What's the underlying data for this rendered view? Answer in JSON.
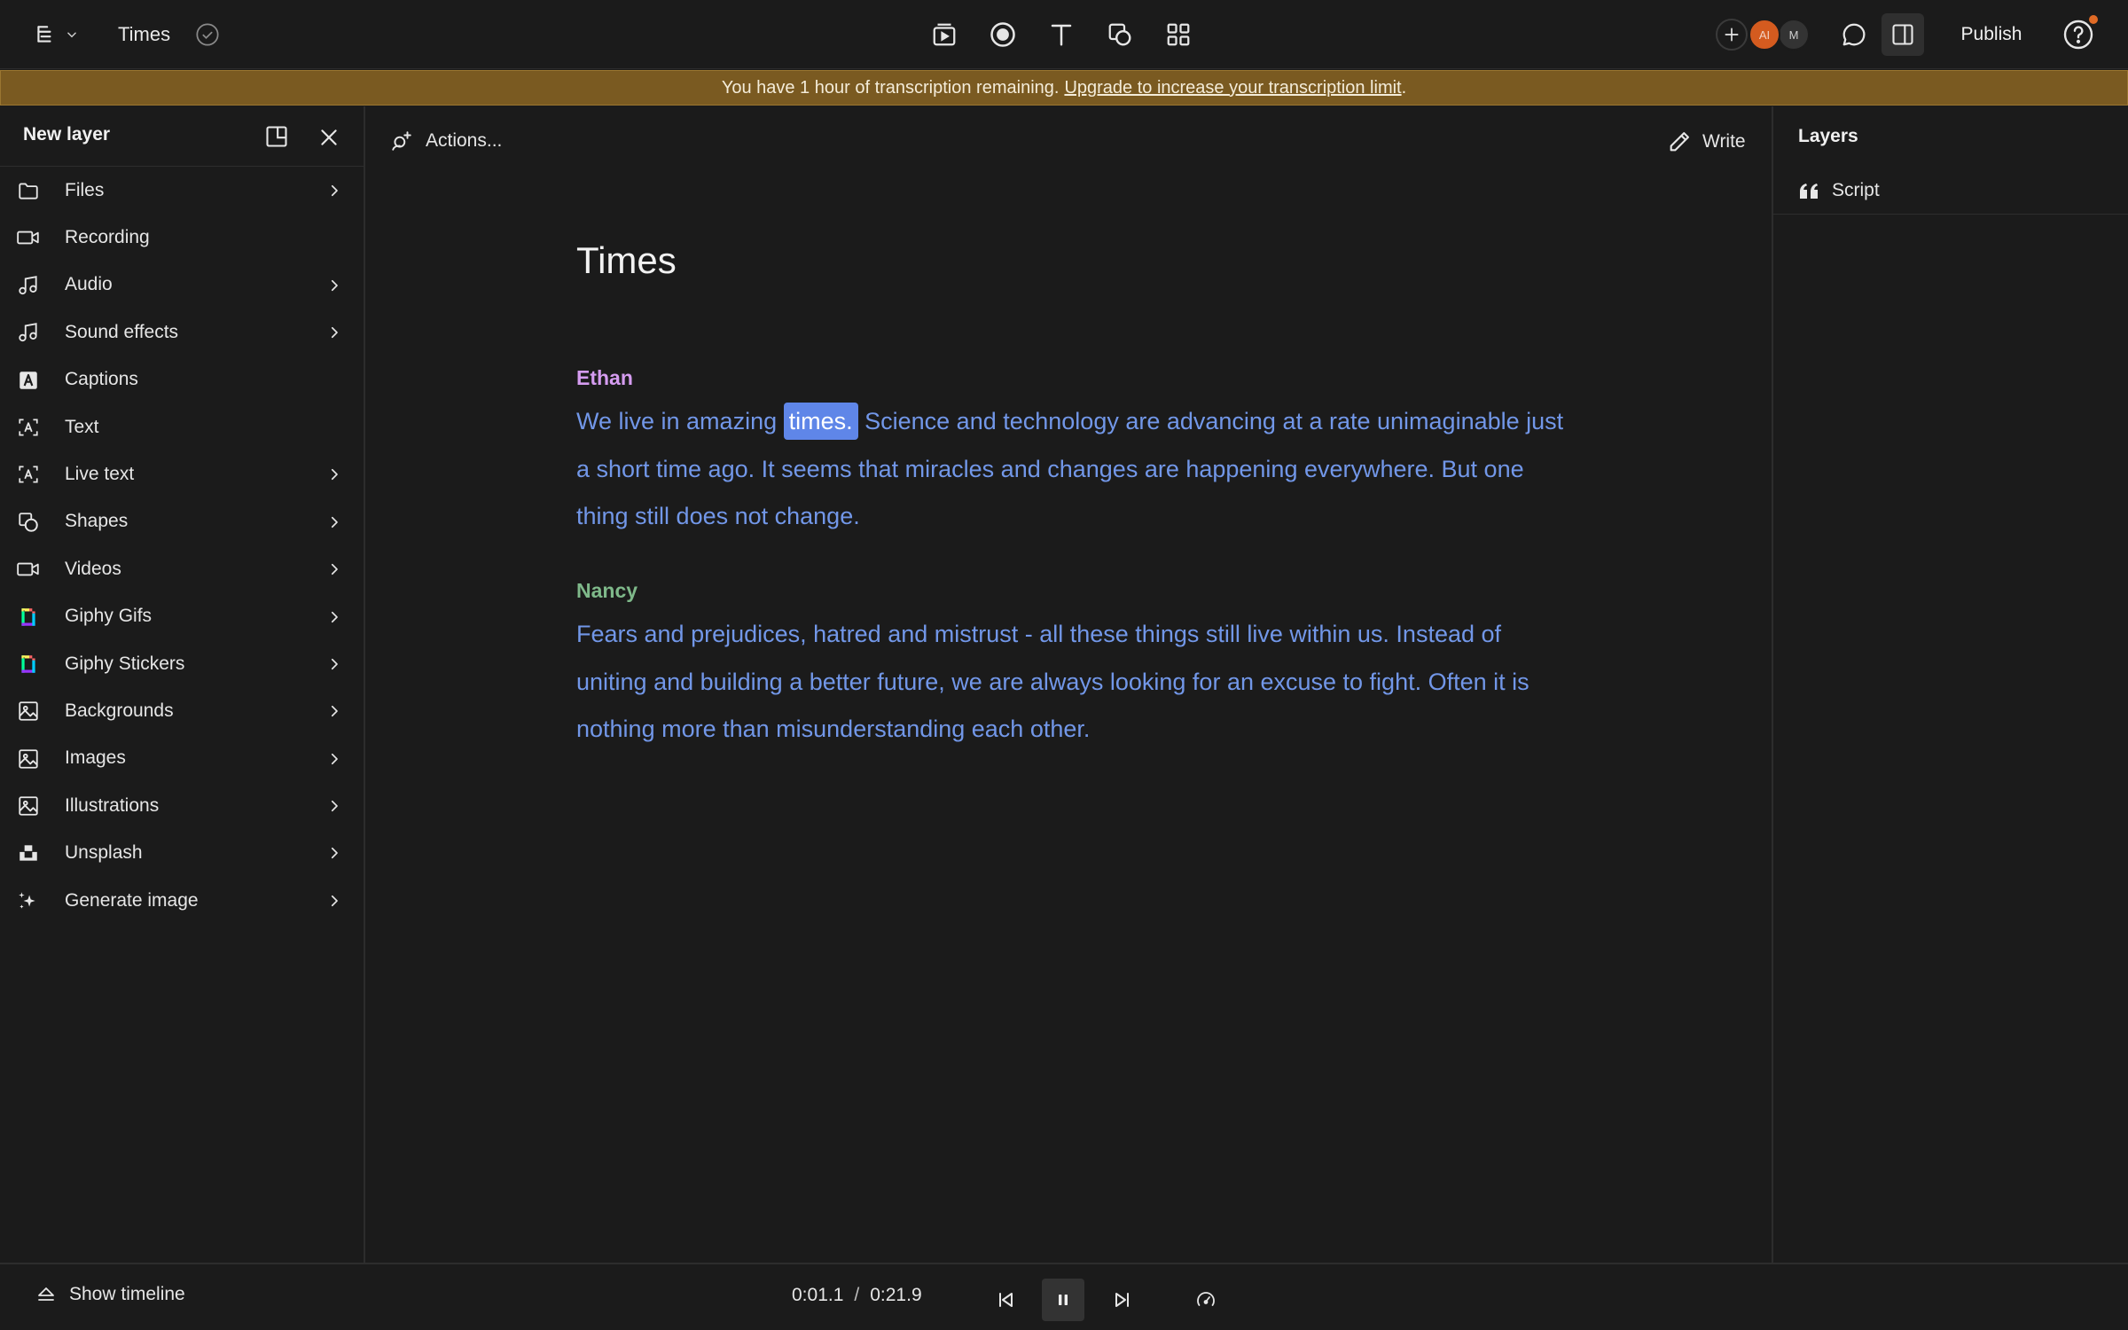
{
  "topbar": {
    "doc_title": "Times",
    "publish_label": "Publish",
    "avatars": [
      "AI",
      "M"
    ]
  },
  "banner": {
    "text": "You have 1 hour of transcription remaining.",
    "link": "Upgrade to increase your transcription limit",
    "suffix": "."
  },
  "left_panel": {
    "title": "New layer",
    "items": [
      {
        "label": "Files",
        "icon": "folder-icon",
        "chevron": true
      },
      {
        "label": "Recording",
        "icon": "camera-icon",
        "chevron": false
      },
      {
        "label": "Audio",
        "icon": "music-note-icon",
        "chevron": true
      },
      {
        "label": "Sound effects",
        "icon": "music-note-icon",
        "chevron": true
      },
      {
        "label": "Captions",
        "icon": "captions-icon",
        "chevron": false
      },
      {
        "label": "Text",
        "icon": "text-box-icon",
        "chevron": false
      },
      {
        "label": "Live text",
        "icon": "text-box-icon",
        "chevron": true
      },
      {
        "label": "Shapes",
        "icon": "shapes-icon",
        "chevron": true
      },
      {
        "label": "Videos",
        "icon": "camera-icon",
        "chevron": true
      },
      {
        "label": "Giphy Gifs",
        "icon": "giphy-icon",
        "chevron": true
      },
      {
        "label": "Giphy Stickers",
        "icon": "giphy-icon",
        "chevron": true
      },
      {
        "label": "Backgrounds",
        "icon": "image-icon",
        "chevron": true
      },
      {
        "label": "Images",
        "icon": "image-icon",
        "chevron": true
      },
      {
        "label": "Illustrations",
        "icon": "image-icon",
        "chevron": true
      },
      {
        "label": "Unsplash",
        "icon": "unsplash-icon",
        "chevron": true
      },
      {
        "label": "Generate image",
        "icon": "sparkle-icon",
        "chevron": true
      }
    ]
  },
  "editor": {
    "actions_label": "Actions...",
    "write_label": "Write",
    "title": "Times",
    "segments": [
      {
        "speaker": "Ethan",
        "speaker_color": "#d59cf0",
        "before": "We live in amazing ",
        "highlight": "times.",
        "after": " Science and technology are advancing at a rate unimaginable just a short time ago. It seems that miracles and changes are happening everywhere. But one thing still does not change."
      },
      {
        "speaker": "Nancy",
        "speaker_color": "#7fb98a",
        "before": "",
        "highlight": "",
        "after": "Fears and prejudices, hatred and mistrust - all these things still live within us. Instead of uniting and building a better future, we are always looking for an excuse to fight. Often it is nothing more than misunderstanding each other."
      }
    ]
  },
  "layers_panel": {
    "title": "Layers",
    "items": [
      {
        "label": "Script",
        "icon": "quote-icon"
      }
    ]
  },
  "bottom": {
    "show_timeline_label": "Show timeline",
    "current_time": "0:01.1",
    "separator": "/",
    "total_time": "0:21.9"
  }
}
